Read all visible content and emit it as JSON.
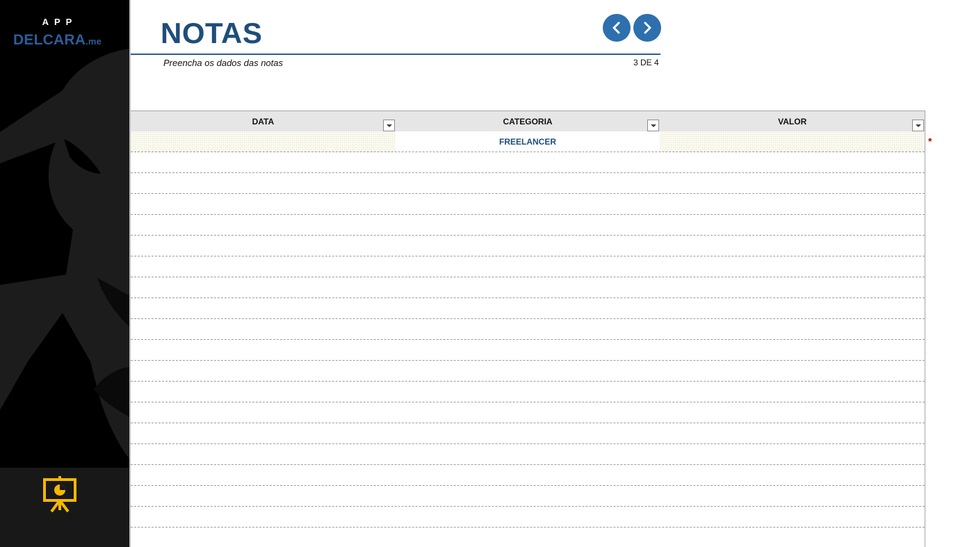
{
  "sidebar": {
    "brand_top": "APP",
    "brand_name": "DELCARA",
    "brand_suffix": ".me",
    "bottom_icon": "presentation-chart-icon"
  },
  "header": {
    "title": "NOTAS",
    "subtitle": "Preencha os dados das notas",
    "page_indicator": "3 DE 4",
    "prev_icon": "chevron-left-icon",
    "next_icon": "chevron-right-icon"
  },
  "table": {
    "columns": [
      "DATA",
      "CATEGORIA",
      "VALOR"
    ],
    "rows": [
      [
        "",
        "FREELANCER",
        ""
      ]
    ],
    "required_marker": "*"
  },
  "colors": {
    "accent": "#2e6fad",
    "title": "#1f4e79",
    "header_bg": "#e7e6e6",
    "icon_gold": "#f5b800",
    "required": "#c00000"
  }
}
